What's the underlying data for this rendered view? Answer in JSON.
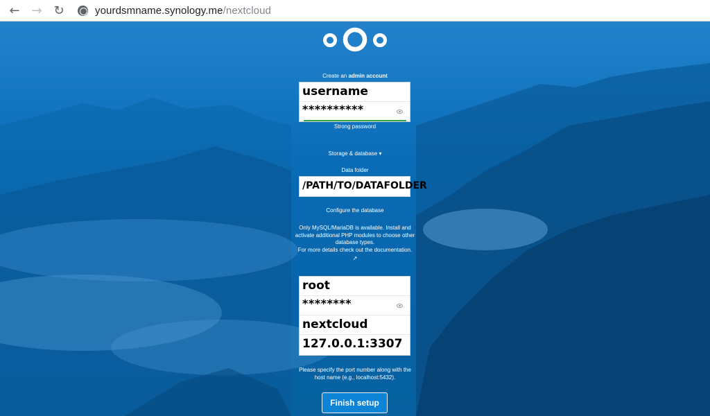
{
  "browser": {
    "url_host": "yourdsmname.synology.me",
    "url_path": "/nextcloud",
    "icons": {
      "back": "back-arrow-icon",
      "forward": "forward-arrow-icon",
      "reload": "reload-icon",
      "site": "globe-icon"
    }
  },
  "setup": {
    "admin_prefix": "Create an",
    "admin_bold": "admin account",
    "admin_username": "username",
    "admin_password": "**********",
    "strength_label": "Strong password",
    "storage_toggle": "Storage & database ▾",
    "data_folder_label": "Data folder",
    "data_folder_value": "/PATH/TO/DATAFOLDER",
    "configure_db_label": "Configure the database",
    "db_note_line1": "Only MySQL/MariaDB is available. Install and",
    "db_note_line2": "activate additional PHP modules to choose other",
    "db_note_line3": "database types.",
    "db_note_line4": "For more details check out the documentation.",
    "db_note_link_icon": "↗",
    "db_user": "root",
    "db_password": "********",
    "db_name": "nextcloud",
    "db_host": "127.0.0.1:3307",
    "port_hint_line1": "Please specify the port number along with the",
    "port_hint_line2": "host name (e.g., localhost:5432).",
    "finish_button": "Finish setup"
  },
  "colors": {
    "background": "#0a6db8",
    "button": "#0e84d6",
    "strength_bar": "#35a745"
  }
}
